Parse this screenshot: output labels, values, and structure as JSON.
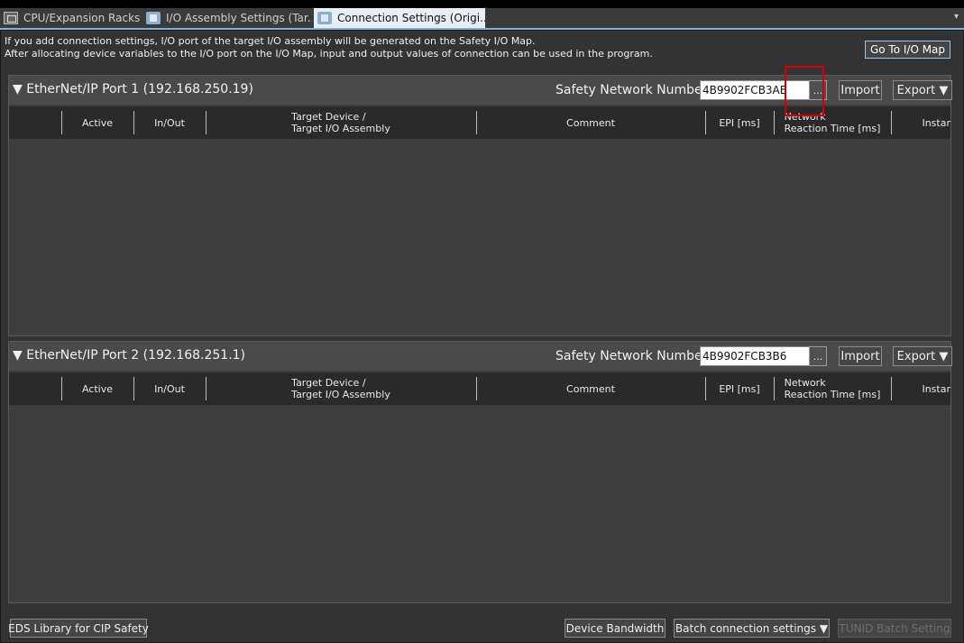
{
  "tabs": [
    {
      "label": "CPU/Expansion Racks",
      "active": false,
      "icon": "rack-icon"
    },
    {
      "label": "I/O Assembly Settings (Tar...",
      "active": false,
      "icon": "io-icon"
    },
    {
      "label": "Connection Settings (Origi...",
      "active": true,
      "icon": "io-icon",
      "close": "✕"
    }
  ],
  "tab_menu_glyph": "▾",
  "info": {
    "line1": "If you add connection settings, I/O port of the target I/O assembly will be generated on the Safety I/O Map.",
    "line2": "After allocating device variables to the I/O port on the I/O Map, input and output values of connection can be used in the program."
  },
  "goto_button": "Go To I/O Map",
  "columns": {
    "active": "Active",
    "inout": "In/Out",
    "target_line1": "Target Device /",
    "target_line2": "Target I/O Assembly",
    "comment": "Comment",
    "epi": "EPI [ms]",
    "reaction_line1": "Network",
    "reaction_line2": "Reaction Time [ms]",
    "instance": "Instar"
  },
  "ports": [
    {
      "title": "▼ EtherNet/IP Port 1 (192.168.250.19)",
      "snn_label": "Safety Network Number :",
      "snn_value": "4B9902FCB3AB",
      "ellipsis": "...",
      "import_label": "Import",
      "export_label": "Export ▼"
    },
    {
      "title": "▼ EtherNet/IP Port 2 (192.168.251.1)",
      "snn_label": "Safety Network Number :",
      "snn_value": "4B9902FCB3B6",
      "ellipsis": "...",
      "import_label": "Import",
      "export_label": "Export ▼"
    }
  ],
  "bottom": {
    "eds": "EDS Library for CIP Safety",
    "bandwidth": "Device Bandwidth",
    "batch": "Batch connection settings ▼",
    "tunid": "TUNID Batch Setting"
  },
  "colors": {
    "background": "#333333",
    "panel": "#3d3d3d",
    "header": "#2a2a2a",
    "accent": "#7ab4dc",
    "highlight": "#d40000"
  }
}
